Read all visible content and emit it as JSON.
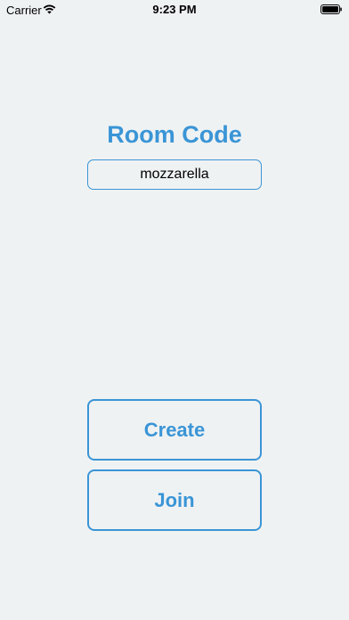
{
  "status_bar": {
    "carrier": "Carrier",
    "time": "9:23 PM",
    "icons": [
      "wifi-icon",
      "battery-icon"
    ]
  },
  "title": "Room Code",
  "room_code_input": {
    "value": "mozzarella"
  },
  "buttons": {
    "create": "Create",
    "join": "Join"
  },
  "colors": {
    "accent": "#3a95d6",
    "background": "#eff2f3"
  }
}
